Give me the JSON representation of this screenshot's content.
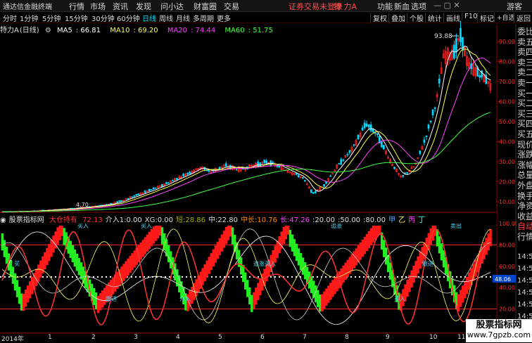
{
  "titlebar": {
    "app_name": "通达信金融终端",
    "menus": [
      "行情",
      "市场",
      "资讯",
      "发现",
      "问小达",
      "财富圈",
      "交易"
    ],
    "warning": "证券交易未登录",
    "stock": "特 力A",
    "right_menus": [
      "功能",
      "新血",
      "选项"
    ],
    "user": "游客"
  },
  "toolbar": {
    "periods": [
      "分时",
      "1分钟",
      "5分钟",
      "15分钟",
      "30分钟",
      "60分钟",
      "日线",
      "周线",
      "月线",
      "多周期",
      "更多"
    ],
    "active_period": "日线",
    "right_buttons": [
      "复权",
      "叠加",
      "个股",
      "统计",
      "画线",
      "F10",
      "标记",
      "+自选",
      "返回"
    ]
  },
  "main_chart": {
    "name": "特力A",
    "period": "(日线)",
    "ma": [
      {
        "label": "MA5",
        "value": "66.81",
        "color": "#ffffff"
      },
      {
        "label": "MA10",
        "value": "69.20",
        "color": "#ffff44"
      },
      {
        "label": "MA20",
        "value": "74.44",
        "color": "#ff44ff"
      },
      {
        "label": "MA60",
        "value": "51.75",
        "color": "#44ff44"
      }
    ],
    "y_ticks": [
      "90.00",
      "80.00",
      "70.00",
      "60.00",
      "50.00",
      "40.00",
      "30.00",
      "20.00",
      "10.00"
    ],
    "high_label": "93.88",
    "low_label": "4.70"
  },
  "sub_chart": {
    "title": "股票指标网",
    "indicator": "大仓持有",
    "values": [
      {
        "label": "",
        "value": "72.13",
        "color": "#ff3333"
      },
      {
        "label": "介入1:",
        "value": "0.00",
        "color": "#dddddd"
      },
      {
        "label": "XG:",
        "value": "0.00",
        "color": "#dddddd"
      },
      {
        "label": "短:",
        "value": "28.86",
        "color": "#aaaa00"
      },
      {
        "label": "中:",
        "value": "22.80",
        "color": "#dddddd"
      },
      {
        "label": "中长:",
        "value": "10.76",
        "color": "#ff8800"
      },
      {
        "label": "长:",
        "value": "47.26",
        "color": "#ff44ff"
      },
      {
        "label": "",
        "value": ":20.00",
        "color": "#dddddd"
      },
      {
        "label": "",
        "value": ":50.00",
        "color": "#dddddd"
      },
      {
        "label": "",
        "value": ":80.00",
        "color": "#dddddd"
      },
      {
        "label": "甲",
        "value": "",
        "color": "#44aaff"
      },
      {
        "label": "乙",
        "value": "",
        "color": "#ffff44"
      },
      {
        "label": "丙",
        "value": "",
        "color": "#ff44ff"
      },
      {
        "label": "丁",
        "value": "",
        "color": "#44ffff"
      }
    ],
    "y_ticks": [
      "100.00",
      "80.00",
      "60.00",
      "40.00",
      "20.00"
    ],
    "current_value": "48.06",
    "annotations": [
      "买入",
      "跟进",
      "买",
      "买入",
      "介入",
      "追涨买入",
      "追涨",
      "买入",
      "跟进",
      "卖出"
    ]
  },
  "time_axis": [
    "2014年",
    "1",
    "2",
    "3",
    "4",
    "5",
    "6",
    "7",
    "8",
    "9",
    "10",
    "11"
  ],
  "sidebar": {
    "items": [
      "委比",
      "卖五",
      "卖四",
      "卖三",
      "卖二",
      "卖一",
      "买一",
      "买二",
      "买三",
      "买四",
      "买五",
      "现价",
      "涨跌",
      "涨幅",
      "总量",
      "外盘",
      "换手",
      "净资",
      "收益",
      "自动",
      "行情"
    ],
    "times": [
      "14:50",
      "14:50",
      "14:50",
      "14:50",
      "14:50",
      "14:50",
      "14:50"
    ]
  },
  "watermark": {
    "line1": "股票指标网",
    "line2": "www.7gpzb.com"
  },
  "colors": {
    "up": "#ff2222",
    "down": "#00d8ff",
    "ma5": "#ffffff",
    "ma10": "#ffff44",
    "ma20": "#ff44ff",
    "ma60": "#44ff44",
    "frame": "#8b0000"
  }
}
